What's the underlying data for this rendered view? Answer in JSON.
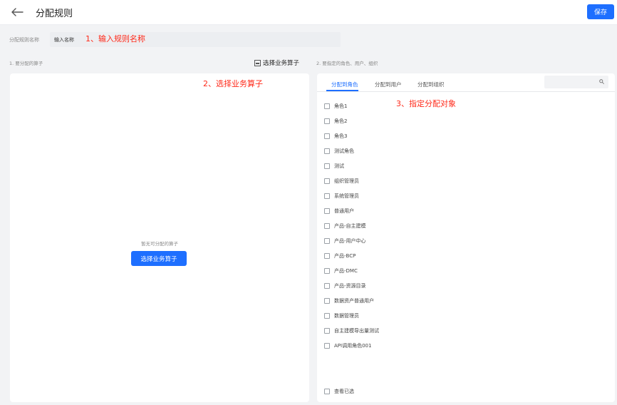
{
  "header": {
    "title": "分配规则",
    "save_label": "保存"
  },
  "name_field": {
    "label": "分配规则名称",
    "value": "输入名称"
  },
  "annotations": {
    "step1": "1、输入规则名称",
    "step2": "2、选择业务算子",
    "step3": "3、指定分配对象"
  },
  "left_section": {
    "label": "1. 要分配的算子",
    "select_link": "选择业务算子",
    "empty_text": "暂无可分配的算子",
    "empty_button": "选择业务算子"
  },
  "right_section": {
    "label": "2. 要指定的角色、用户、组织",
    "tabs": [
      {
        "label": "分配到角色",
        "active": true
      },
      {
        "label": "分配到用户",
        "active": false
      },
      {
        "label": "分配到组织",
        "active": false
      }
    ],
    "roles": [
      "角色1",
      "角色2",
      "角色3",
      "测试角色",
      "测试",
      "组织管理员",
      "系统管理员",
      "普通用户",
      "产品-自主建模",
      "产品-用户中心",
      "产品-BCP",
      "产品-DMC",
      "产品-资源目录",
      "数据资产普通用户",
      "数据管理员",
      "自主建模导出量测试",
      "API调用角色001"
    ],
    "view_selected": "查看已选"
  },
  "colors": {
    "accent": "#1e6fff",
    "annotation": "#ff2a1a",
    "background": "#f2f3f5"
  }
}
